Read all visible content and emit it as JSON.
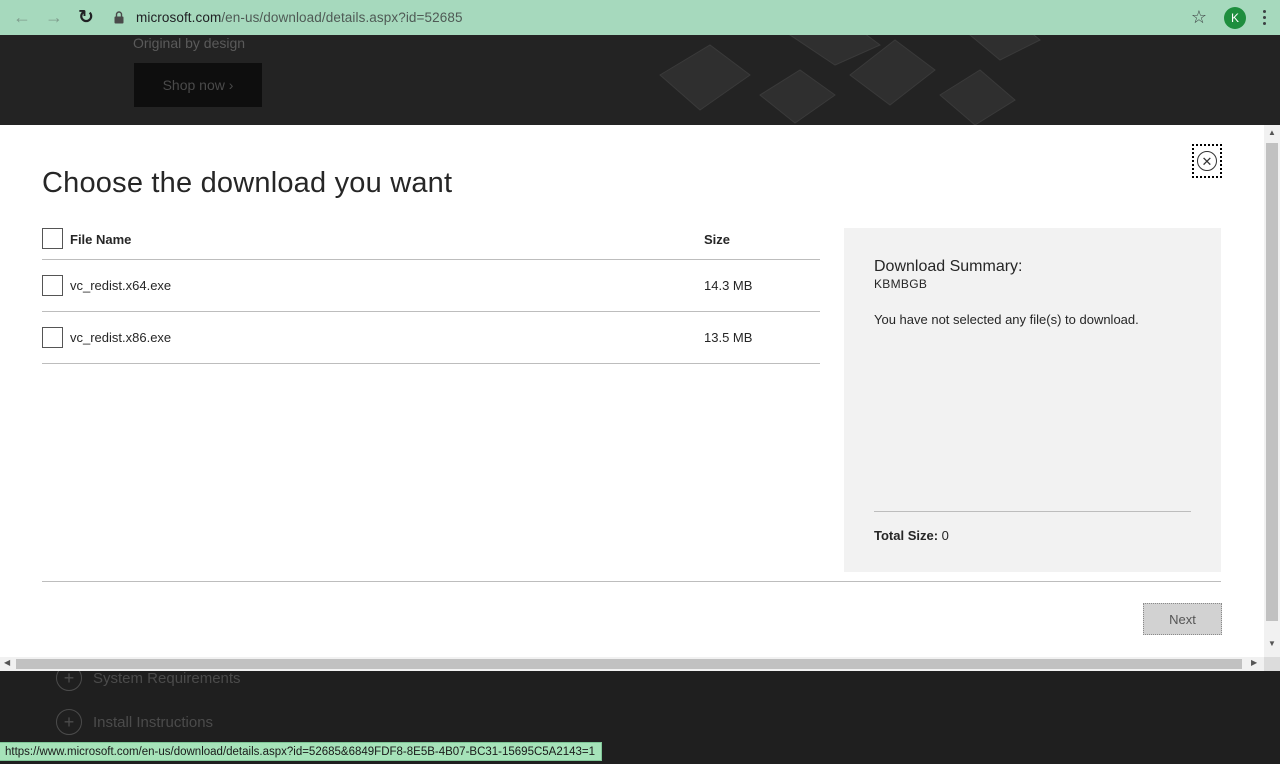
{
  "browser": {
    "url_host": "microsoft.com",
    "url_path": "/en-us/download/details.aspx?id=52685",
    "profile_initial": "K",
    "icons": {
      "back": "arrow-left-icon",
      "forward": "arrow-right-icon",
      "reload": "reload-icon",
      "lock": "lock-icon",
      "star": "star-icon",
      "menu": "kebab-menu-icon"
    }
  },
  "background": {
    "hero_tagline": "Original by design",
    "shop_button": "Shop now ›",
    "sections": [
      "System Requirements",
      "Install Instructions"
    ]
  },
  "dialog": {
    "title": "Choose the download you want",
    "table": {
      "headers": {
        "file_name": "File Name",
        "size": "Size"
      },
      "rows": [
        {
          "file_name": "vc_redist.x64.exe",
          "size": "14.3 MB"
        },
        {
          "file_name": "vc_redist.x86.exe",
          "size": "13.5 MB"
        }
      ]
    },
    "summary": {
      "title": "Download Summary:",
      "code": "KBMBGB",
      "message": "You have not selected any file(s) to download.",
      "total_label": "Total Size:",
      "total_value": "0"
    },
    "next_label": "Next"
  },
  "status_bar": {
    "url": "https://www.microsoft.com/en-us/download/details.aspx?id=52685&6849FDF8-8E5B-4B07-BC31-15695C5A2143=1"
  },
  "colors": {
    "chrome": "#a6d9bd",
    "avatar": "#1e8e3e",
    "summary_bg": "#f2f2f2",
    "status_bg": "#a6e3b9"
  }
}
